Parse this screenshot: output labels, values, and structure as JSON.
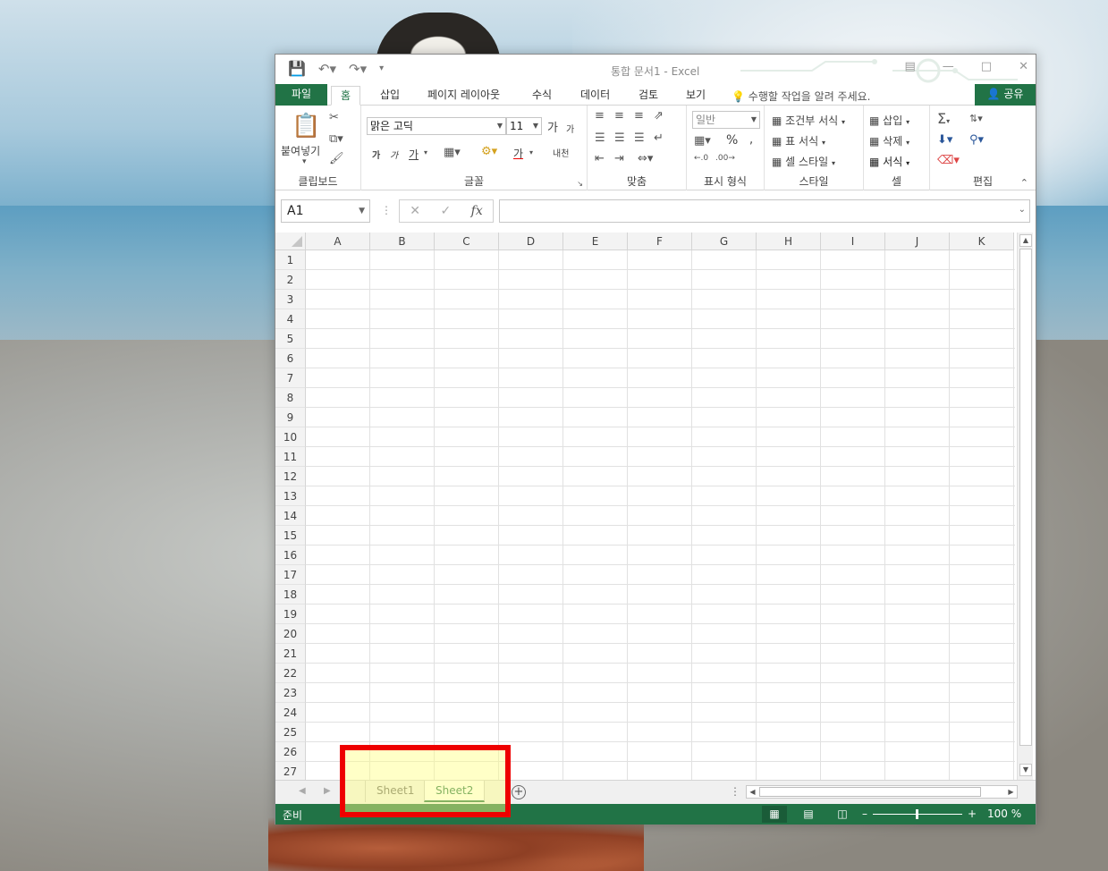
{
  "window": {
    "title": "통합 문서1 - Excel",
    "controls": [
      "restore-ribbon",
      "minimize",
      "maximize",
      "close"
    ]
  },
  "qat": {
    "save_icon": "save-icon",
    "undo_icon": "undo-icon",
    "redo_icon": "redo-icon",
    "customize_icon": "customize-icon"
  },
  "tabs": {
    "file": "파일",
    "items": [
      "홈",
      "삽입",
      "페이지 레이아웃",
      "수식",
      "데이터",
      "검토",
      "보기"
    ],
    "active": "홈",
    "tellme": "수행할 작업을 알려 주세요.",
    "share": "공유"
  },
  "ribbon": {
    "clipboard": {
      "paste": "붙여넣기",
      "label": "클립보드"
    },
    "font": {
      "name": "맑은 고딕",
      "size": "11",
      "grow": "가",
      "shrink": "가",
      "bold": "가",
      "italic": "가",
      "underline": "가",
      "phonetic": "내천",
      "color": "가",
      "label": "글꼴"
    },
    "alignment": {
      "label": "맞춤"
    },
    "number": {
      "format": "일반",
      "percent": "%",
      "comma": ",",
      "label": "표시 형식"
    },
    "styles": {
      "conditional": "조건부 서식",
      "table": "표 서식",
      "cell": "셀 스타일",
      "label": "스타일"
    },
    "cells": {
      "insert": "삽입",
      "delete": "삭제",
      "format": "서식",
      "label": "셀"
    },
    "editing": {
      "label": "편집"
    }
  },
  "formula_bar": {
    "name_box": "A1",
    "fx": "fx",
    "value": ""
  },
  "grid": {
    "columns": [
      "A",
      "B",
      "C",
      "D",
      "E",
      "F",
      "G",
      "H",
      "I",
      "J",
      "K"
    ],
    "rows": [
      "1",
      "2",
      "3",
      "4",
      "5",
      "6",
      "7",
      "8",
      "9",
      "10",
      "11",
      "12",
      "13",
      "14",
      "15",
      "16",
      "17",
      "18",
      "19",
      "20",
      "21",
      "22",
      "23",
      "24",
      "25",
      "26",
      "27"
    ]
  },
  "sheets": {
    "tabs": [
      "Sheet1",
      "Sheet2"
    ],
    "active": "Sheet2"
  },
  "status": {
    "ready": "준비",
    "zoom": "100 %"
  },
  "colors": {
    "accent": "#217346",
    "highlight_border": "#ee0000",
    "highlight_fill": "#ffff82"
  }
}
